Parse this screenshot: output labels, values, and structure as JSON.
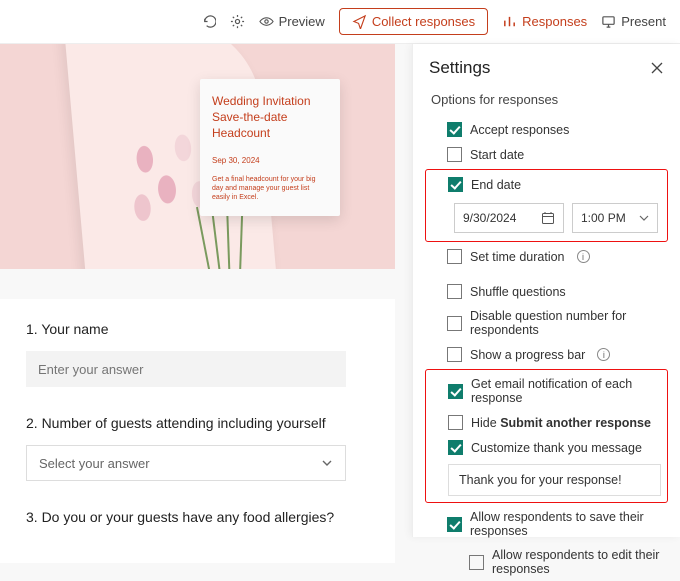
{
  "toolbar": {
    "preview": "Preview",
    "collect": "Collect responses",
    "responses": "Responses",
    "present": "Present"
  },
  "hero": {
    "title": "Wedding Invitation Save-the-date Headcount",
    "date": "Sep 30, 2024",
    "desc": "Get a final headcount for your big day and manage your guest list easily in Excel."
  },
  "questions": {
    "q1": "1. Your name",
    "q1_placeholder": "Enter your answer",
    "q2": "2. Number of guests attending including yourself",
    "q2_placeholder": "Select your answer",
    "q3": "3. Do you or your guests have any food allergies?"
  },
  "panel": {
    "title": "Settings",
    "options_label": "Options for responses",
    "accept": "Accept responses",
    "start_date": "Start date",
    "end_date": "End date",
    "end_date_value": "9/30/2024",
    "end_time_value": "1:00 PM",
    "duration": "Set time duration",
    "shuffle": "Shuffle questions",
    "disable_num": "Disable question number for respondents",
    "progress": "Show a progress bar",
    "email_notif": "Get email notification of each response",
    "hide_prefix": "Hide ",
    "hide_bold": "Submit another response",
    "customize": "Customize thank you message",
    "thank_you": "Thank you for your response!",
    "allow_save": "Allow respondents to save their responses",
    "allow_edit": "Allow respondents to edit their responses"
  }
}
